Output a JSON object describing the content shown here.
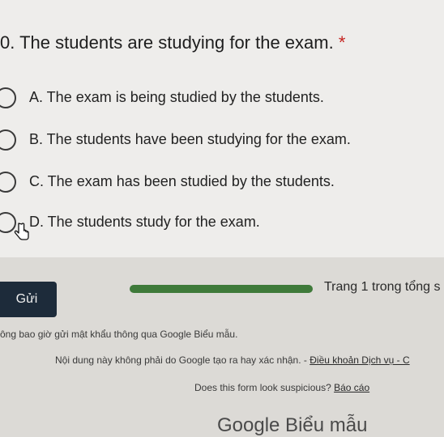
{
  "question": {
    "title": "0. The students are studying for the exam.",
    "required_mark": "*"
  },
  "options": [
    {
      "label": "A. The exam is being studied by the students."
    },
    {
      "label": "B. The students have been studying for the exam."
    },
    {
      "label": "C. The exam has been studied by the students."
    },
    {
      "label": "D. The students study for the exam."
    }
  ],
  "footer": {
    "submit_label": "Gửi",
    "progress_fraction": 1.0,
    "page_text": "Trang 1 trong tổng s",
    "password_warning": "ông bao giờ gửi mật khẩu thông qua Google Biểu mẫu.",
    "disclaimer": "Nội dung này không phải do Google tạo ra hay xác nhận. -",
    "terms_link": "Điều khoản Dịch vụ - C",
    "suspicious_text": "Does this form look suspicious?",
    "report_link": "Báo cáo",
    "brand": "Google Biểu mẫu"
  },
  "icons": {
    "radio": "radio-unchecked-icon",
    "cursor": "hand-pointer-icon"
  },
  "colors": {
    "submit_bg": "#1d2b3a",
    "progress_fill": "#3f7a3a",
    "required": "#c5221f"
  }
}
